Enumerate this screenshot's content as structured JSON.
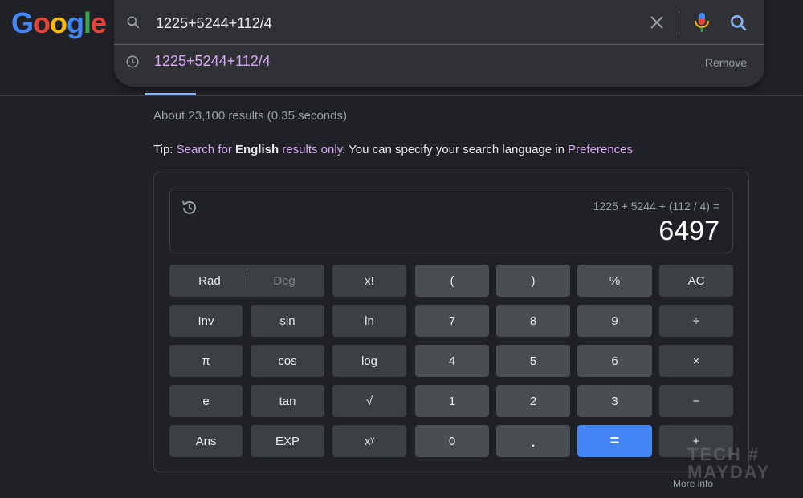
{
  "logo": {
    "letters": [
      "G",
      "o",
      "o",
      "g",
      "l",
      "e"
    ],
    "colors": [
      "#4285f4",
      "#ea4335",
      "#fbbc05",
      "#4285f4",
      "#34a853",
      "#ea4335"
    ]
  },
  "search": {
    "query": "1225+5244+112/4"
  },
  "suggestion": {
    "text": "1225+5244+112/4",
    "remove_label": "Remove"
  },
  "results": {
    "stats": "About 23,100 results (0.35 seconds)"
  },
  "tip": {
    "prefix": "Tip: ",
    "link1": "Search for ",
    "bold": "English",
    "link2": " results only",
    "middle": ". You can specify your search language in ",
    "link3": "Preferences"
  },
  "calculator": {
    "expression": "1225 + 5244 + (112 / 4) =",
    "result": "6497",
    "rad": "Rad",
    "deg": "Deg",
    "keys": {
      "fact": "x!",
      "lparen": "(",
      "rparen": ")",
      "percent": "%",
      "ac": "AC",
      "inv": "Inv",
      "sin": "sin",
      "ln": "ln",
      "n7": "7",
      "n8": "8",
      "n9": "9",
      "div": "÷",
      "pi": "π",
      "cos": "cos",
      "log": "log",
      "n4": "4",
      "n5": "5",
      "n6": "6",
      "mul": "×",
      "e": "e",
      "tan": "tan",
      "sqrt": "√",
      "n1": "1",
      "n2": "2",
      "n3": "3",
      "sub": "−",
      "ans": "Ans",
      "exp": "EXP",
      "pow": "xʸ",
      "n0": "0",
      "dot": ".",
      "eq": "=",
      "add": "+"
    },
    "more_info": "More info"
  },
  "watermark": {
    "line1": "TECH #",
    "line2": "MAYDAY"
  }
}
